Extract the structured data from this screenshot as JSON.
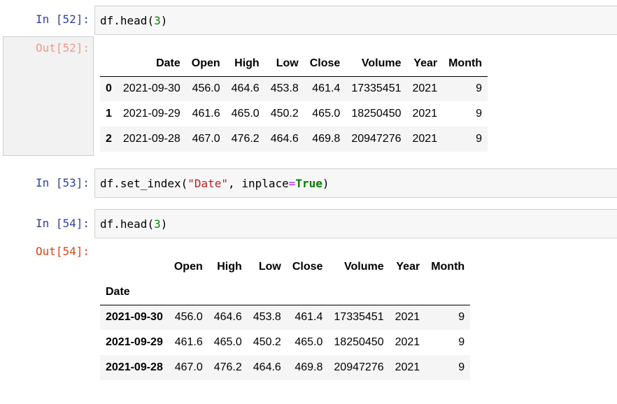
{
  "cells": [
    {
      "in_prompt": "In  [52]:",
      "code": {
        "obj": "df",
        "dot": ".",
        "fn": "head",
        "open": "(",
        "num": "3",
        "close": ")"
      }
    },
    {
      "in_prompt": "In  [53]:",
      "code": {
        "obj": "df",
        "dot": ".",
        "fn": "set_index",
        "open": "(",
        "str": "\"Date\"",
        "comma": ", ",
        "kwarg": "inplace",
        "eq": "=",
        "kw": "True",
        "close": ")"
      }
    },
    {
      "in_prompt": "In  [54]:",
      "code": {
        "obj": "df",
        "dot": ".",
        "fn": "head",
        "open": "(",
        "num": "3",
        "close": ")"
      }
    }
  ],
  "outputs": [
    {
      "out_prompt": "Out[52]:",
      "columns": [
        "",
        "Date",
        "Open",
        "High",
        "Low",
        "Close",
        "Volume",
        "Year",
        "Month"
      ],
      "rows": [
        [
          "0",
          "2021-09-30",
          "456.0",
          "464.6",
          "453.8",
          "461.4",
          "17335451",
          "2021",
          "9"
        ],
        [
          "1",
          "2021-09-29",
          "461.6",
          "465.0",
          "450.2",
          "465.0",
          "18250450",
          "2021",
          "9"
        ],
        [
          "2",
          "2021-09-28",
          "467.0",
          "476.2",
          "464.6",
          "469.8",
          "20947276",
          "2021",
          "9"
        ]
      ]
    },
    {
      "out_prompt": "Out[54]:",
      "columns": [
        "",
        "Open",
        "High",
        "Low",
        "Close",
        "Volume",
        "Year",
        "Month"
      ],
      "index_name": "Date",
      "rows": [
        [
          "2021-09-30",
          "456.0",
          "464.6",
          "453.8",
          "461.4",
          "17335451",
          "2021",
          "9"
        ],
        [
          "2021-09-29",
          "461.6",
          "465.0",
          "450.2",
          "465.0",
          "18250450",
          "2021",
          "9"
        ],
        [
          "2021-09-28",
          "467.0",
          "476.2",
          "464.6",
          "469.8",
          "20947276",
          "2021",
          "9"
        ]
      ]
    }
  ]
}
